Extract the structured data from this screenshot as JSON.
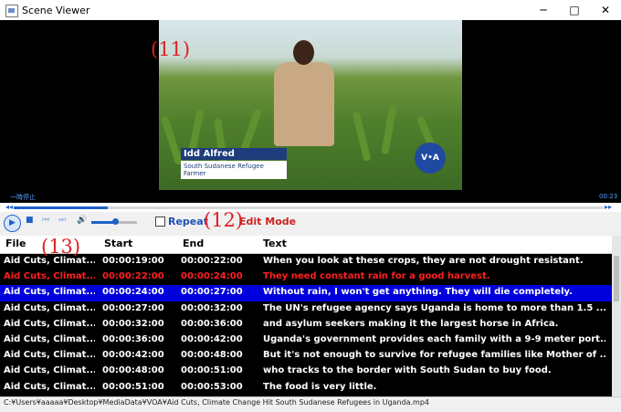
{
  "window": {
    "title": "Scene Viewer",
    "minimize": "─",
    "maximize": "□",
    "close": "✕"
  },
  "video": {
    "name_tag": "Idd Alfred",
    "name_tag_sub": "South Sudanese Refugee Farmer",
    "logo": "V•A",
    "status_left": "一時停止",
    "status_right": "00:23",
    "annotation": "(11)"
  },
  "player": {
    "progress_fraction": 0.16,
    "volume_fraction": 0.52,
    "repeat_label": "Repeat",
    "repeat_checked": false,
    "edit_mode_label": "Edit Mode",
    "annotation": "(12)",
    "icons": [
      "play-icon",
      "stop-icon",
      "previous-icon",
      "next-icon",
      "volume-icon"
    ]
  },
  "table": {
    "headers": {
      "file": "File",
      "start": "Start",
      "end": "End",
      "text": "Text"
    },
    "annotation": "(13)",
    "rows": [
      {
        "file": "Aid Cuts, Climat...",
        "start": "00:00:19:00",
        "end": "00:00:22:00",
        "text": "When you look at these crops, they are not drought resistant.",
        "style": "normal"
      },
      {
        "file": "Aid Cuts, Climat...",
        "start": "00:00:22:00",
        "end": "00:00:24:00",
        "text": "They need constant rain for a good harvest.",
        "style": "red"
      },
      {
        "file": "Aid Cuts, Climat...",
        "start": "00:00:24:00",
        "end": "00:00:27:00",
        "text": "Without rain, I won't get anything. They will die completely.",
        "style": "selected"
      },
      {
        "file": "Aid Cuts, Climat...",
        "start": "00:00:27:00",
        "end": "00:00:32:00",
        "text": "The UN's refugee agency says Uganda is home to more than 1.5 ...",
        "style": "normal"
      },
      {
        "file": "Aid Cuts, Climat...",
        "start": "00:00:32:00",
        "end": "00:00:36:00",
        "text": "and asylum seekers making it the largest horse in Africa.",
        "style": "normal"
      },
      {
        "file": "Aid Cuts, Climat...",
        "start": "00:00:36:00",
        "end": "00:00:42:00",
        "text": "Uganda's government provides each family with a 9-9 meter port...",
        "style": "normal"
      },
      {
        "file": "Aid Cuts, Climat...",
        "start": "00:00:42:00",
        "end": "00:00:48:00",
        "text": "But it's not enough to survive for refugee families like Mother of ...",
        "style": "normal"
      },
      {
        "file": "Aid Cuts, Climat...",
        "start": "00:00:48:00",
        "end": "00:00:51:00",
        "text": "who tracks to the border with South Sudan to buy food.",
        "style": "normal"
      },
      {
        "file": "Aid Cuts, Climat...",
        "start": "00:00:51:00",
        "end": "00:00:53:00",
        "text": "The food is very little.",
        "style": "normal"
      }
    ]
  },
  "status_bar": {
    "path": "C:¥Users¥aaaaa¥Desktop¥MediaData¥VOA¥Aid Cuts, Climate Change Hit South Sudanese Refugees in Uganda.mp4"
  },
  "colors": {
    "accent": "#1e62c8",
    "selected_row": "#0000dd",
    "red_text": "#ff2020",
    "annotation": "#d22222"
  }
}
